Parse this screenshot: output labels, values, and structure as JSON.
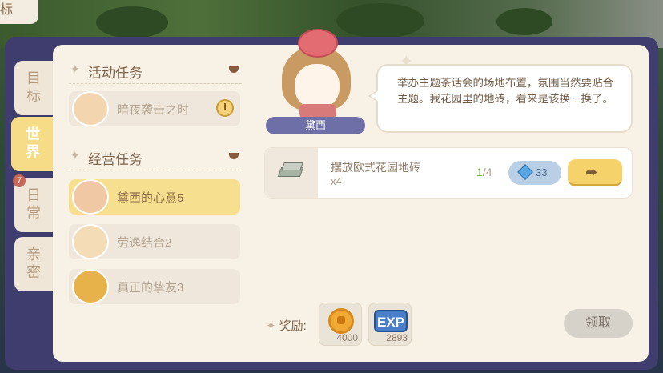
{
  "top_tag": "标",
  "side_tabs": [
    {
      "label": "目标",
      "active": false
    },
    {
      "label": "世界",
      "active": true
    },
    {
      "label": "日常",
      "active": false,
      "badge": "7"
    },
    {
      "label": "亲密",
      "active": false
    }
  ],
  "sections": {
    "activity": {
      "title": "活动任务",
      "items": [
        {
          "label": "暗夜袭击之时"
        }
      ]
    },
    "business": {
      "title": "经营任务",
      "items": [
        {
          "label": "黛西的心意5",
          "selected": true
        },
        {
          "label": "劳逸结合2",
          "selected": false
        },
        {
          "label": "真正的挚友3",
          "selected": false
        }
      ]
    }
  },
  "npc": {
    "name": "黛西",
    "dialogue": "举办主题茶话会的场地布置，氛围当然要贴合主题。我花园里的地砖，看来是该换一换了。"
  },
  "task": {
    "name": "摆放欧式花园地砖",
    "count": "x4",
    "progress_current": "1",
    "progress_total": "/4",
    "gem_reward": "33"
  },
  "reward": {
    "label": "奖励:",
    "coin_value": "4000",
    "exp_label": "EXP",
    "exp_value": "2893",
    "claim_label": "领取"
  },
  "colors": {
    "frame": "#3f3d6e",
    "panel": "#f7f1e6",
    "active_tab": "#f6dc86",
    "selected_item": "#f7df90",
    "go_button": "#f6d26b",
    "progress_current": "#74b35a"
  }
}
